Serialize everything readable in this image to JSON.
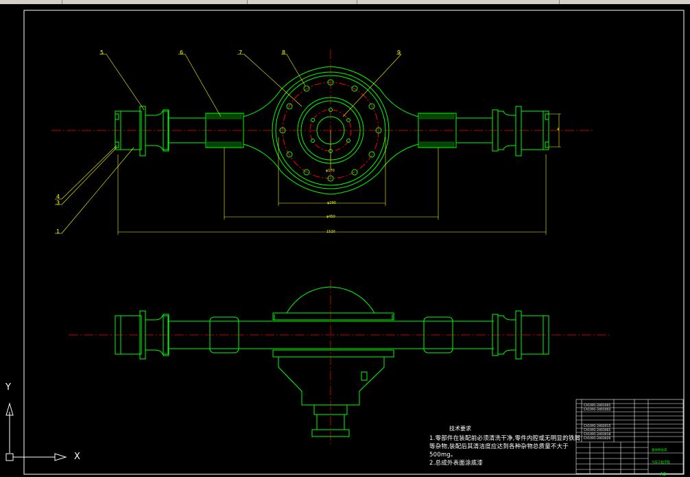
{
  "balloons": [
    "5",
    "6",
    "7",
    "8",
    "9",
    "4",
    "3",
    "1"
  ],
  "dimensions": [
    "4",
    "φ170",
    "φ290",
    "φ450",
    "1520"
  ],
  "technical_notes": {
    "title": "技术要求",
    "lines": [
      "1.零部件在装配前必须清洗干净,零件内腔或无明显的铁屑",
      "等杂物,装配后其清洁度应达到各种杂物总质量不大于",
      "500mg。",
      "2.总成外表面涂底漆"
    ]
  },
  "title_block": {
    "sheet_size": "A0",
    "rows": [
      "CA1091-2401001",
      "CA1091-2401002",
      "CA1091-2402015",
      "CA1091-2403001",
      "CA1091-2403018",
      "CA1091-2403020"
    ],
    "drawing_title": "驱动桥总成",
    "school": "汽车工程学院"
  },
  "ucs": {
    "x_label": "X",
    "y_label": "Y"
  },
  "colors": {
    "outline": "#00ff00",
    "centerline": "#ff0000",
    "dimension": "#ffff00",
    "border": "#ffffff",
    "background": "#000000"
  }
}
